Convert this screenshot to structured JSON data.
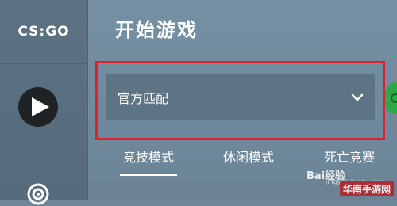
{
  "app": {
    "logo": "CS:GO"
  },
  "header": {
    "title": "开始游戏"
  },
  "mode_select": {
    "selected": "官方匹配"
  },
  "tabs": [
    {
      "label": "竞技模式",
      "active": true
    },
    {
      "label": "休闲模式",
      "active": false
    },
    {
      "label": "死亡竞赛",
      "active": false
    }
  ],
  "watermark": {
    "text": "Bai经验",
    "sub": "jingyan.baidu.com",
    "site": "华南手游网"
  },
  "colors": {
    "highlight": "#e0212b",
    "panel": "#5e7384",
    "sidebar": "#566b7b"
  }
}
